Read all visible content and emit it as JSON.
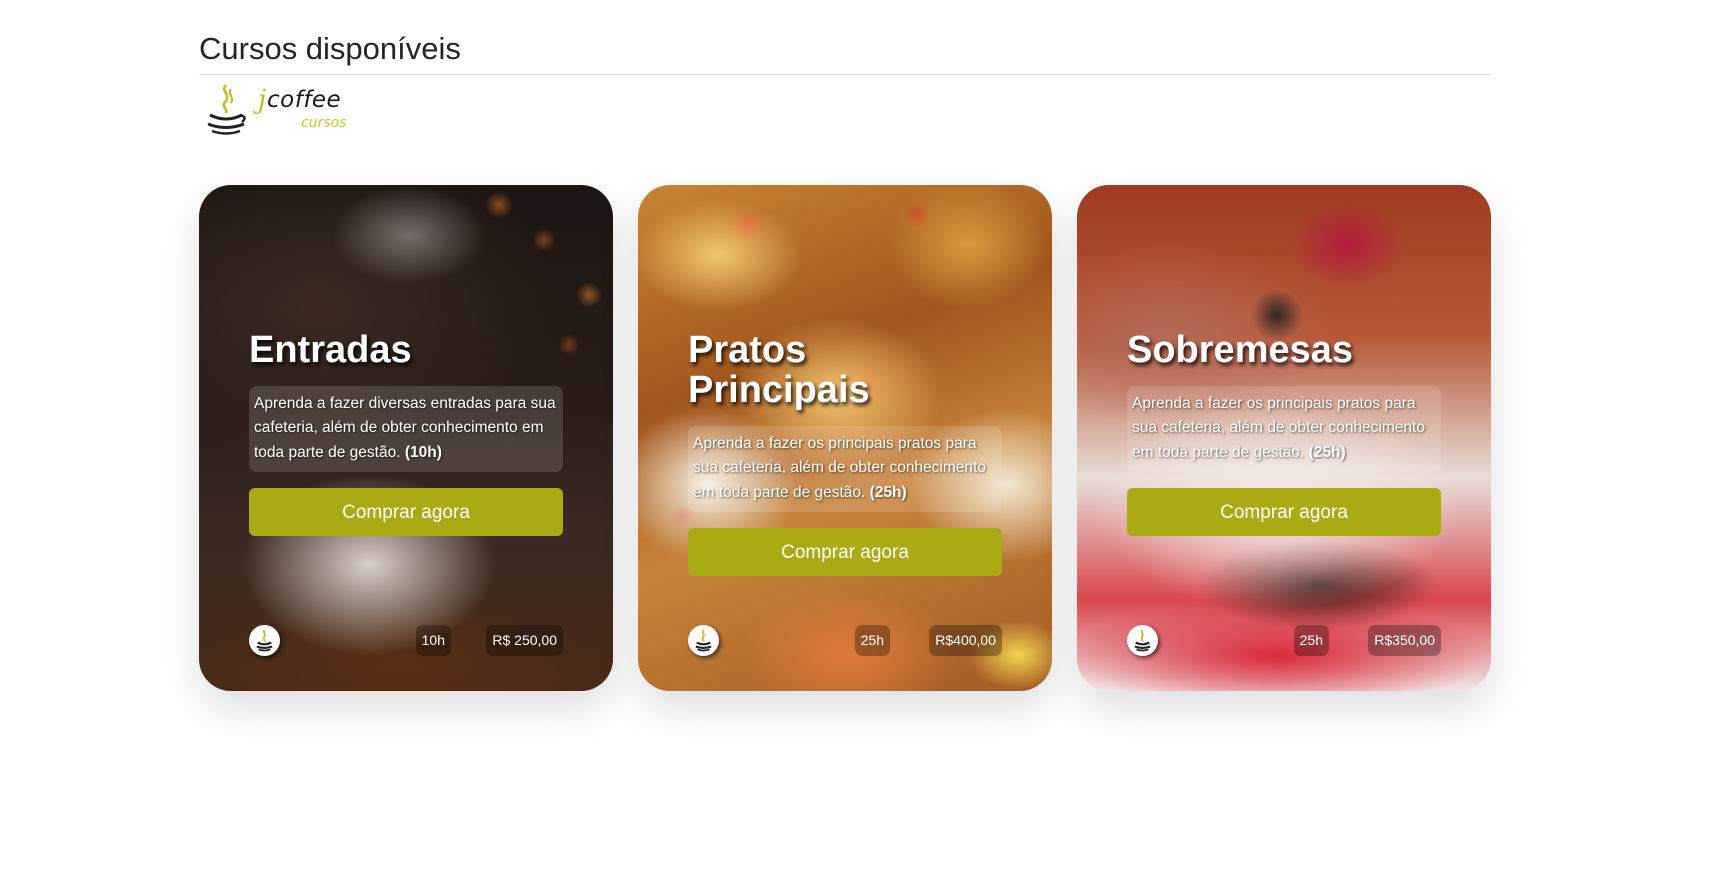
{
  "page": {
    "title": "Cursos disponíveis"
  },
  "logo": {
    "j": "j",
    "coffee": "coffee",
    "cursos": "cursos",
    "icon": "coffee-cup-icon"
  },
  "courses": [
    {
      "title": "Entradas",
      "description": "Aprenda a fazer diversas entradas para sua cafeteria, além de obter conhecimento em toda parte de gestão.",
      "duration_bold": "(10h)",
      "button_label": "Comprar agora",
      "hours_badge": "10h",
      "price_badge": "R$ 250,00"
    },
    {
      "title": "Pratos Principais",
      "description": "Aprenda a fazer os principais pratos para sua cafeteria, além de obter conhecimento em toda parte de gestão.",
      "duration_bold": "(25h)",
      "button_label": "Comprar agora",
      "hours_badge": "25h",
      "price_badge": "R$400,00"
    },
    {
      "title": "Sobremesas",
      "description": "Aprenda a fazer os principais pratos para sua cafeteria, além de obter conhecimento em toda parte de gestão.",
      "duration_bold": "(25h)",
      "button_label": "Comprar agora",
      "hours_badge": "25h",
      "price_badge": "R$350,00"
    }
  ],
  "colors": {
    "button": "#a9aa14",
    "logo_accent": "#c9b91f"
  }
}
